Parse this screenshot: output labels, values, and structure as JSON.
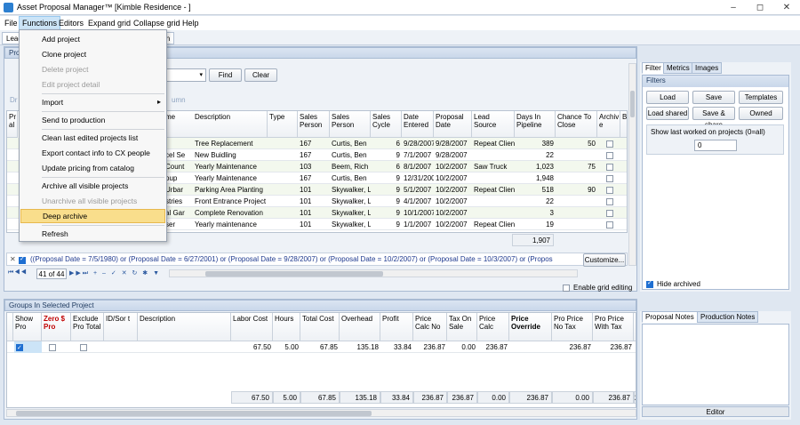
{
  "window": {
    "title": "Asset Proposal Manager™ [Kimble Residence - ]"
  },
  "menu": [
    "File",
    "Functions",
    "Editors",
    "Expand grid",
    "Collapse grid",
    "Help"
  ],
  "tabs": [
    "Leac",
    "ln"
  ],
  "projects_panel": {
    "title": "Pro",
    "find": "Find",
    "clear": "Clear",
    "dr_hint": "Dr",
    "column_hint": "umn"
  },
  "functions_menu": {
    "items": [
      {
        "label": "Add project",
        "disabled": false
      },
      {
        "label": "Clone project",
        "disabled": false
      },
      {
        "label": "Delete project",
        "disabled": true
      },
      {
        "label": "Edit project detail",
        "disabled": true
      },
      {
        "sep": true
      },
      {
        "label": "Import",
        "disabled": false,
        "submenu": true
      },
      {
        "sep": true
      },
      {
        "label": "Send to production",
        "disabled": false
      },
      {
        "sep": true
      },
      {
        "label": "Clean last edited projects list",
        "disabled": false
      },
      {
        "label": "Export contact info to CX people",
        "disabled": false
      },
      {
        "label": "Update pricing from catalog",
        "disabled": false
      },
      {
        "sep": true
      },
      {
        "label": "Archive all visible projects",
        "disabled": false
      },
      {
        "label": "Unarchive all visible projects",
        "disabled": true
      },
      {
        "label": "Deep archive",
        "disabled": false,
        "highlight": true
      },
      {
        "sep": true
      },
      {
        "label": "Refresh",
        "disabled": false
      }
    ]
  },
  "project_grid": {
    "headers": [
      "Pr al",
      "me",
      "Description",
      "Type",
      "Sales Person",
      "Sales Person",
      "Sales Cycle",
      "Date Entered",
      "Proposal Date",
      "Lead Source",
      "Days In Pipeline",
      "Chance To Close",
      "Archiv e",
      "Bic"
    ],
    "rows": [
      [
        "",
        "",
        "Tree Replacement",
        "",
        "167",
        "Curtis, Ben",
        "6",
        "9/28/2007",
        "9/28/2007",
        "Repeat Clien",
        "389",
        "50"
      ],
      [
        "",
        "cel Se",
        "New Buidling",
        "",
        "167",
        "Curtis, Ben",
        "9",
        "7/1/2007",
        "9/28/2007",
        "",
        "22",
        ""
      ],
      [
        "",
        "Count",
        "Yearly Maintenance",
        "",
        "103",
        "Beem, Rich",
        "6",
        "8/1/2007",
        "10/2/2007",
        "Saw Truck",
        "1,023",
        "75"
      ],
      [
        "",
        "oup",
        "Yearly Maintenance",
        "",
        "167",
        "Curtis, Ben",
        "9",
        "12/31/2007",
        "10/2/2007",
        "",
        "1,948",
        ""
      ],
      [
        "",
        "Urbar",
        "Parking Area Planting",
        "",
        "101",
        "Skywalker, L",
        "9",
        "5/1/2007",
        "10/2/2007",
        "Repeat Clien",
        "518",
        "90"
      ],
      [
        "",
        "stries",
        "Front Entrance Project",
        "",
        "101",
        "Skywalker, L",
        "9",
        "4/1/2007",
        "10/2/2007",
        "",
        "22",
        ""
      ],
      [
        "",
        "al Gar",
        "Complete Renovation",
        "",
        "101",
        "Skywalker, L",
        "9",
        "10/1/2007",
        "10/2/2007",
        "",
        "3",
        ""
      ],
      [
        "",
        "ser",
        "Yearly maintenance",
        "",
        "101",
        "Skywalker, L",
        "9",
        "1/1/2007",
        "10/2/2007",
        "Repeat Clien",
        "19",
        ""
      ]
    ],
    "total_days": "1,907",
    "filter_text": "((Proposal Date = 7/5/1980) or (Proposal Date = 6/27/2001) or (Proposal Date = 9/28/2007) or (Proposal Date = 10/2/2007) or (Proposal Date = 10/3/2007) or (Propos",
    "customize": "Customize...",
    "record_pos": "41 of 44",
    "enable_editing": "Enable grid editing"
  },
  "side_panel": {
    "tabs": [
      "Filter",
      "Metrics",
      "Images"
    ],
    "filters_title": "Filters",
    "buttons": [
      "Load",
      "Save",
      "Templates",
      "Load shared",
      "Save & share",
      "Owned"
    ],
    "last_worked_label": "Show last worked on projects (0=all)",
    "last_worked_value": "0",
    "hide_archived": "Hide archived"
  },
  "groups": {
    "title": "Groups In Selected Project",
    "headers": [
      "Show Pro",
      "Zero $ Pro",
      "Exclude Pro Total",
      "ID/Sor t",
      "Description",
      "Labor Cost",
      "Hours",
      "Total Cost",
      "Overhead",
      "Profit",
      "Price Calc No",
      "Tax On Sale",
      "Price Calc",
      "Price Override",
      "Pro Price No Tax",
      "Pro Price With Tax",
      "Gi M"
    ],
    "row": [
      "",
      "",
      "",
      "",
      "",
      "67.50",
      "5.00",
      "67.85",
      "135.18",
      "33.84",
      "236.87",
      "0.00",
      "236.87",
      "",
      "236.87",
      "236.87"
    ],
    "totals": [
      "67.50",
      "5.00",
      "67.85",
      "135.18",
      "33.84",
      "236.87",
      "236.87",
      "0.00",
      "236.87",
      "0.00",
      "236.87",
      "236.87"
    ]
  },
  "notes": {
    "tabs": [
      "Proposal Notes",
      "Production Notes"
    ],
    "editor": "Editor"
  },
  "colors": {
    "highlight": "#f9de8c",
    "accent": "#1f6fd1"
  }
}
